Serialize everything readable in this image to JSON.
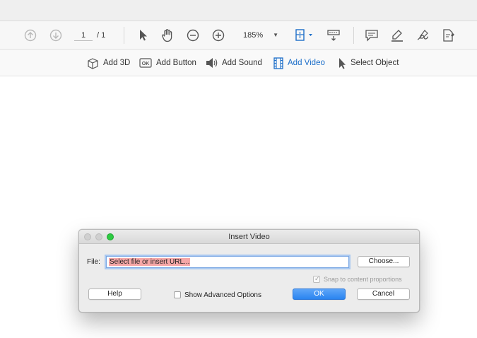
{
  "toolbar": {
    "page_current": "1",
    "page_total": "/ 1",
    "zoom_value": "185%",
    "icons": [
      "arrow-up-circle-icon",
      "arrow-down-circle-icon",
      "pointer-icon",
      "hand-icon",
      "zoom-out-icon",
      "zoom-in-icon",
      "fit-page-icon",
      "scroll-mode-icon",
      "comment-icon",
      "highlighter-icon",
      "sign-icon",
      "fill-sign-icon"
    ]
  },
  "subtoolbar": {
    "items": [
      {
        "label": "Add 3D",
        "icon": "cube-icon"
      },
      {
        "label": "Add Button",
        "icon": "ok-button-icon",
        "badge": "OK"
      },
      {
        "label": "Add Sound",
        "icon": "speaker-icon"
      },
      {
        "label": "Add Video",
        "icon": "film-icon",
        "active": true
      },
      {
        "label": "Select Object",
        "icon": "pointer-icon"
      }
    ],
    "active_color": "#1c6ec9"
  },
  "dialog": {
    "title": "Insert Video",
    "file_label": "File:",
    "file_value": "Select file or insert URL...",
    "choose_label": "Choose...",
    "snap_label": "Snap to content proportions",
    "snap_checked": true,
    "help_label": "Help",
    "advanced_label": "Show Advanced Options",
    "advanced_checked": false,
    "ok_label": "OK",
    "cancel_label": "Cancel"
  }
}
